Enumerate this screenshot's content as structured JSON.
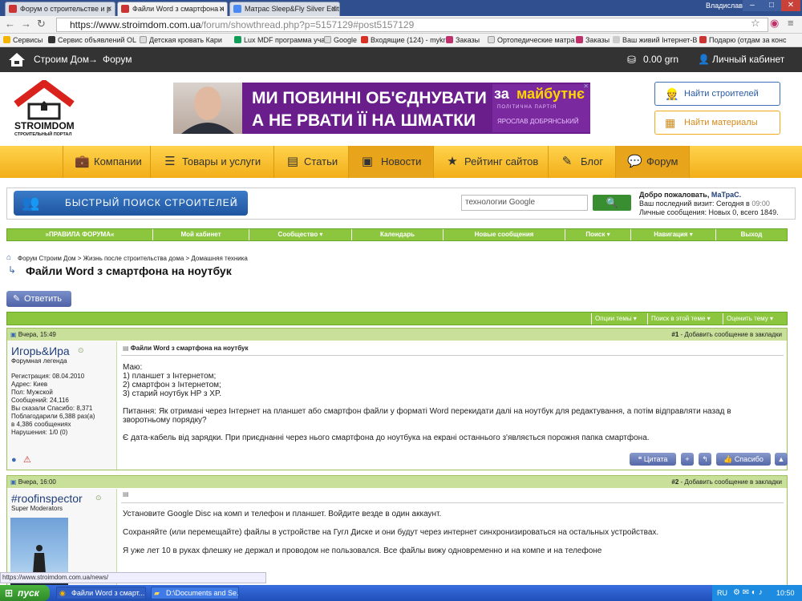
{
  "browser": {
    "tabs": [
      {
        "title": "Форум о строительстве и р",
        "active": false
      },
      {
        "title": "Файли Word з смартфона н",
        "active": true
      },
      {
        "title": "Матрас Sleep&Fly Silver Edit",
        "active": false
      }
    ],
    "user": "Владислав",
    "url_host": "https://www.stroimdom.com.ua",
    "url_path": "/forum/showthread.php?p=5157129#post5157129",
    "bookmarks": [
      "Сервисы",
      "Сервис объявлений OL",
      "Детская кровать Кари",
      "Lux MDF программа уча",
      "Google",
      "Входящие (124) - mykr",
      "Заказы",
      "Ортопедические матра",
      "Заказы",
      "Ваш живий Інтернет-В",
      "Подарю (отдам за конс"
    ]
  },
  "sitebar": {
    "home": "Строим Дом",
    "arrow": "→",
    "forum": "Форум",
    "balance": "0.00 grn",
    "cabinet": "Личный кабинет"
  },
  "header": {
    "logo_name": "STROIMDOM",
    "logo_sub": "СТРОИТЕЛЬНЫЙ ПОРТАЛ",
    "banner_line1": "МИ ПОВИННІ ОБ'ЄДНУВАТИ КРАЇНУ,",
    "banner_line2": "А НЕ РВАТИ ЇЇ НА ШМАТКИ",
    "banner_za": "за",
    "banner_brand": "майбутнє",
    "banner_party": "ПОЛІТИЧНА ПАРТІЯ",
    "banner_person": "ЯРОСЛАВ ДОБРЯНСЬКИЙ",
    "find_builders": "Найти строителей",
    "find_materials": "Найти материалы"
  },
  "nav": {
    "items": [
      {
        "label": "Компании"
      },
      {
        "label": "Товары и услуги"
      },
      {
        "label": "Статьи"
      },
      {
        "label": "Новости"
      },
      {
        "label": "Рейтинг сайтов"
      },
      {
        "label": "Блог"
      },
      {
        "label": "Форум"
      }
    ]
  },
  "search": {
    "quick_search": "БЫСТРЫЙ ПОИСК СТРОИТЕЛЕЙ",
    "placeholder": "технологии Google",
    "welcome_prefix": "Добро пожаловать,",
    "welcome_user": "МаТраС.",
    "last_visit": "Ваш последний визит: Сегодня в",
    "last_visit_time": "09:00",
    "messages": "Личные сообщения: Новых 0, всего 1849."
  },
  "forumbar": {
    "items": [
      "»ПРАВИЛА ФОРУМА«",
      "Мой кабинет",
      "Сообщество ▾",
      "Календарь",
      "Новые сообщения",
      "Поиск ▾",
      "Навигация ▾",
      "Выход"
    ]
  },
  "thread": {
    "crumbs": "Форум Строим Дом > Жизнь после строительства дома > Домашняя техника",
    "title": "Файли Word з смартфона на ноутбук",
    "reply": "Ответить",
    "tools": [
      "Опции темы ▾",
      "Поиск в этой теме ▾",
      "Оценить тему ▾"
    ]
  },
  "post1": {
    "date": "Вчера, 15:49",
    "num": "#1",
    "bookmark": "Добавить сообщение в закладки",
    "user": "Игорь&Ира",
    "user_title": "Форумная легенда",
    "stats": "Регистрация: 08.04.2010\nАдрес: Киев\nПол: Мужской\nСообщений: 24,116\nВы сказали Спасибо: 8,371\nПоблагодарили 6,388 раз(а)\nв 4,386 сообщениях\nНарушения: 1/0 (0)",
    "title": "Файли Word з смартфона на ноутбук",
    "text": "Маю:\n1) планшет з Інтернетом;\n2) смартфон з Інтернетом;\n3) старий ноутбук HP з XP.\n\nПитання: Як отримані через Інтернет на планшет або смартфон файли у форматі Word перекидати далі на ноутбук для редактування, а потім відправляти назад в зворотньому порядку?\n\nЄ дата-кабель від зарядки. При приєднанні через нього смартфона до ноутбука на екрані останнього з'являється порожня папка смартфона.",
    "quote": "Цитата",
    "thanks": "Спасибо"
  },
  "post2": {
    "date": "Вчера, 16:00",
    "num": "#2",
    "bookmark": "Добавить сообщение в закладки",
    "user": "#roofinspector",
    "user_title": "Super Moderators",
    "p1": "Установите Google Disc на комп и телефон и планшет. Войдите везде в один аккаунт.",
    "p2": "Сохраняйте (или перемещайте) файлы в устройстве на Гугл Диске и они будут через интернет синхронизироваться на остальных устройствах.",
    "p3": "Я уже лет 10 в руках флешку не держал и проводом не пользовался. Все файлы вижу одновременно и на компе и на телефоне"
  },
  "statusbar": "https://www.stroimdom.com.ua/news/",
  "taskbar": {
    "start": "пуск",
    "tasks": [
      "Файли Word з смарт...",
      "D:\\Documents and Se..."
    ],
    "lang": "RU",
    "time": "10:50"
  }
}
